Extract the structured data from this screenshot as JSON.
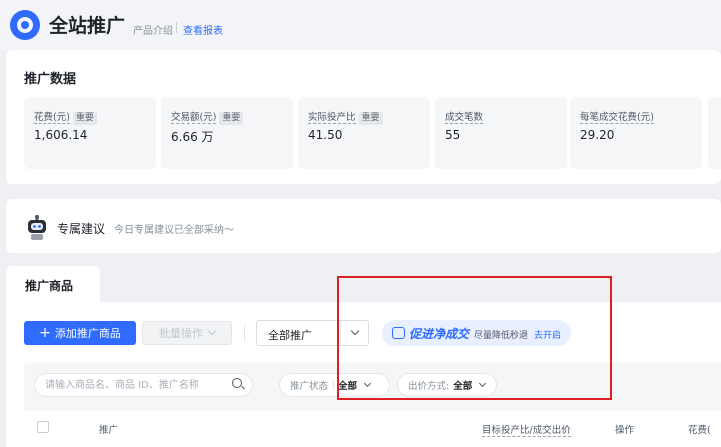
{
  "header": {
    "title": "全站推广",
    "product_intro": "产品介绍",
    "view_report": "查看报表",
    "link_color": "#2f6bff"
  },
  "data_section": {
    "title": "推广数据",
    "metrics": [
      {
        "label": "花费(元)",
        "tag": "重要",
        "value": "1,606.14"
      },
      {
        "label": "交易额(元)",
        "tag": "重要",
        "value": "6.66 万"
      },
      {
        "label": "实际投产比",
        "tag": "重要",
        "value": "41.50"
      },
      {
        "label": "成交笔数",
        "tag": "",
        "value": "55"
      },
      {
        "label": "每笔成交花费(元)",
        "tag": "",
        "value": "29.20"
      }
    ]
  },
  "advice": {
    "icon": "robot-icon",
    "title": "专属建议",
    "text": "今日专属建议已全部采纳～"
  },
  "products": {
    "tab_label": "推广商品",
    "add_button": "添加推广商品",
    "batch_button": "批量操作",
    "scope_select": "全部推广",
    "promo_title": "促进净成交",
    "promo_subtitle": "尽量降低秒退",
    "promo_link": "去开启",
    "search_placeholder": "请输入商品名、商品 ID、推广名称",
    "filters": [
      {
        "key": "推广状态",
        "value": "全部"
      },
      {
        "key": "出价方式:",
        "value": "全部"
      }
    ],
    "columns": [
      "推广",
      "目标投产比/成交出价",
      "操作",
      "花费("
    ]
  }
}
